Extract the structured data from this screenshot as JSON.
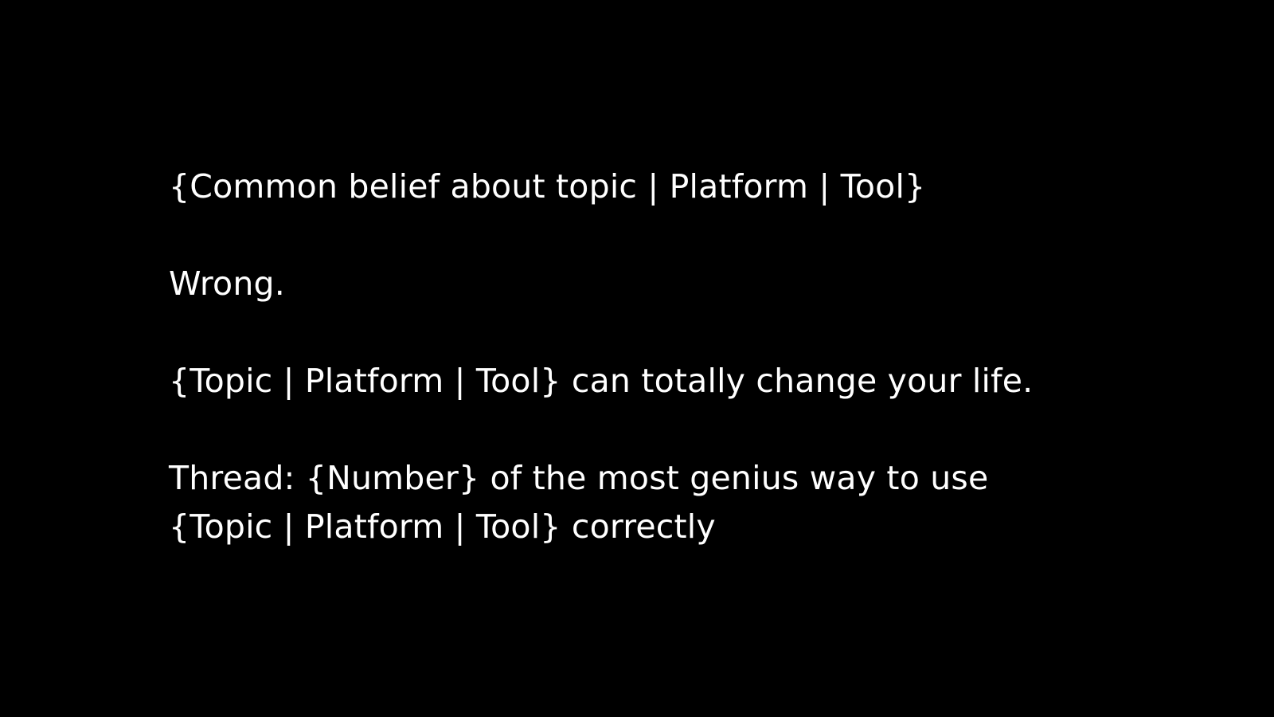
{
  "slide": {
    "background": "#000000",
    "text_color": "#ffffff",
    "lines": {
      "belief": "{Common belief about topic | Platform | Tool}",
      "wrong": "Wrong.",
      "claim": "{Topic | Platform | Tool} can totally change your life.",
      "thread_line1": "Thread: {Number} of the most genius way to use",
      "thread_line2": "{Topic | Platform | Tool} correctly"
    }
  }
}
